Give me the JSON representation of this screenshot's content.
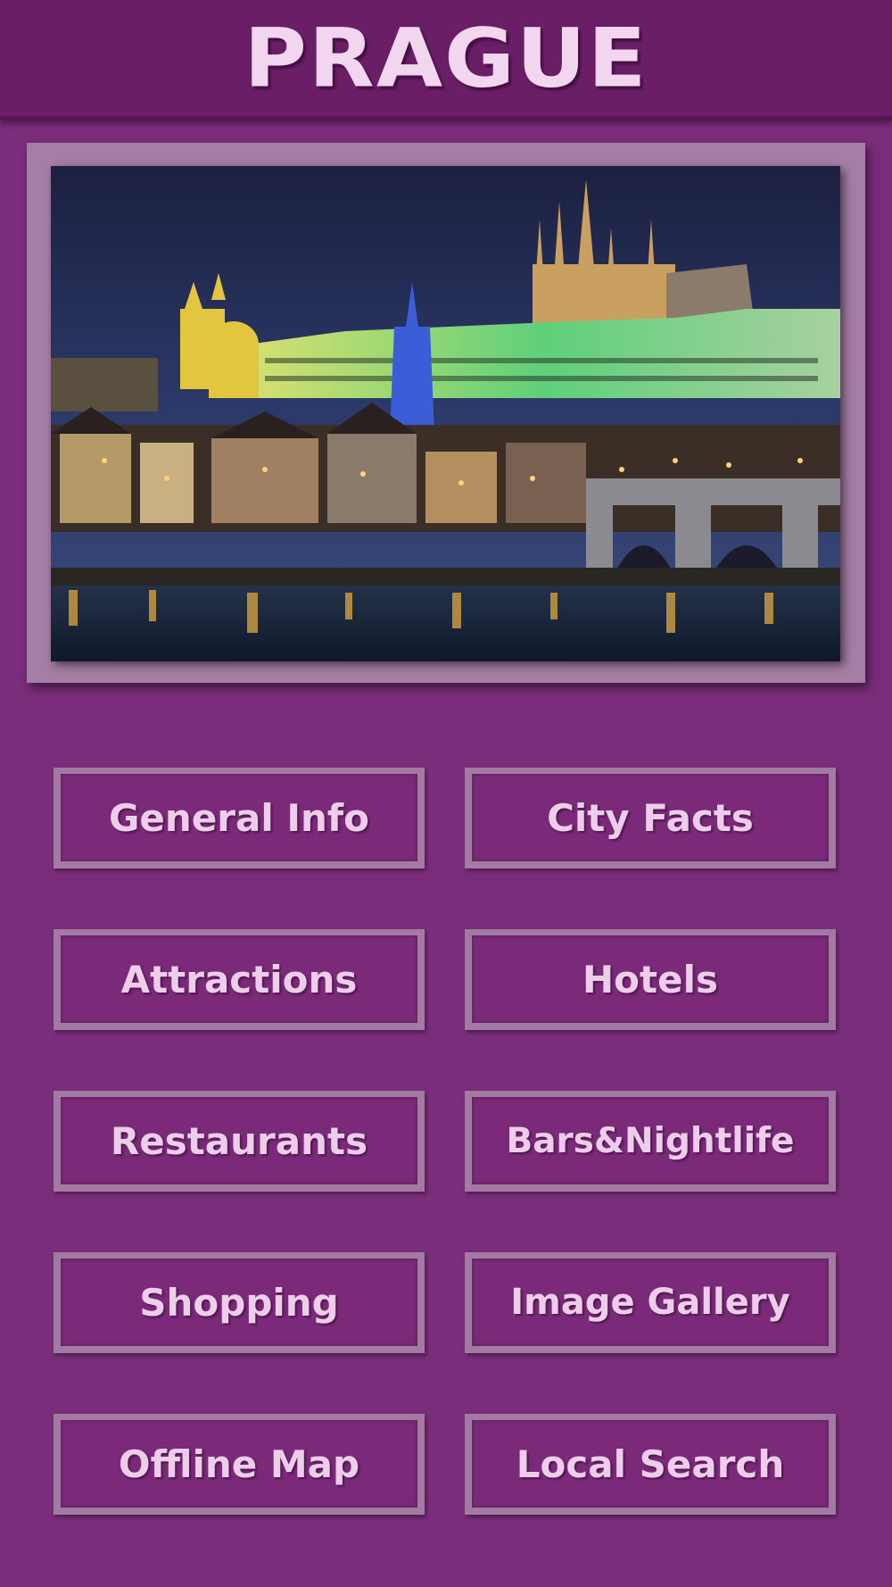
{
  "header": {
    "title": "PRAGUE"
  },
  "hero": {
    "image": "prague-castle-night-photo"
  },
  "menu": [
    {
      "label": "General Info"
    },
    {
      "label": "City Facts"
    },
    {
      "label": "Attractions"
    },
    {
      "label": "Hotels"
    },
    {
      "label": "Restaurants"
    },
    {
      "label": "Bars&Nightlife"
    },
    {
      "label": "Shopping"
    },
    {
      "label": "Image Gallery"
    },
    {
      "label": "Offline Map"
    },
    {
      "label": "Local Search"
    }
  ],
  "colors": {
    "background": "#7a2d7a",
    "header": "#6a1e66",
    "text": "#eecdeb",
    "button_border": "#a27aa2"
  }
}
